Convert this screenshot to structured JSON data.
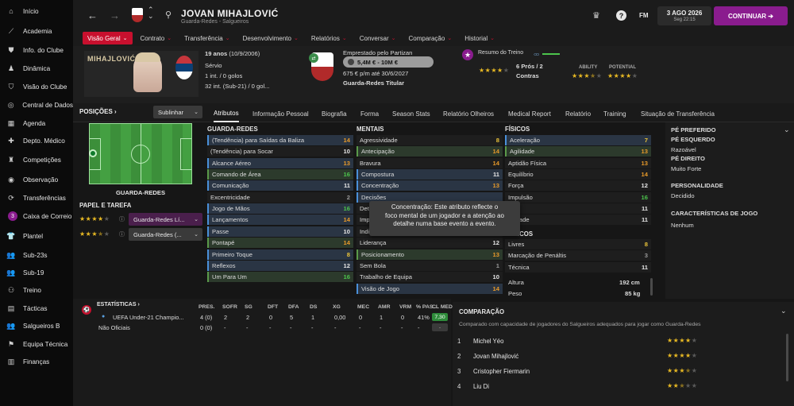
{
  "sidebar": {
    "items": [
      {
        "label": "Início",
        "icon": "home-icon"
      },
      {
        "label": "Academia",
        "icon": "academy-icon"
      },
      {
        "label": "Info. do Clube",
        "icon": "club-info-icon"
      },
      {
        "label": "Dinâmica",
        "icon": "dynamics-icon"
      },
      {
        "label": "Visão do Clube",
        "icon": "club-vision-icon"
      },
      {
        "label": "Central de Dados",
        "icon": "data-hub-icon"
      },
      {
        "label": "Agenda",
        "icon": "calendar-icon"
      },
      {
        "label": "Depto. Médico",
        "icon": "medical-icon"
      },
      {
        "label": "Competições",
        "icon": "trophy-icon"
      },
      {
        "label": "Observação",
        "icon": "scouting-icon"
      },
      {
        "label": "Transferências",
        "icon": "transfers-icon"
      },
      {
        "label": "Caixa de Correio",
        "icon": "inbox-icon",
        "badge": "3"
      },
      {
        "label": "Plantel",
        "icon": "squad-icon"
      },
      {
        "label": "Sub-23s",
        "icon": "u23-icon"
      },
      {
        "label": "Sub-19",
        "icon": "u19-icon"
      },
      {
        "label": "Treino",
        "icon": "training-icon"
      },
      {
        "label": "Tácticas",
        "icon": "tactics-icon"
      },
      {
        "label": "Salgueiros B",
        "icon": "reserve-team-icon"
      },
      {
        "label": "Equipa Técnica",
        "icon": "staff-icon"
      },
      {
        "label": "Finanças",
        "icon": "finances-icon"
      }
    ]
  },
  "header": {
    "player_name": "JOVAN MIHAJLOVIĆ",
    "player_subtitle": "Guarda-Redes - Salgueiros",
    "date": "3 AGO 2026",
    "time": "Seg 22:15",
    "fm_label": "FM",
    "continue_label": "CONTINUAR"
  },
  "nav_tabs": [
    "Visão Geral",
    "Contrato",
    "Transferência",
    "Desenvolvimento",
    "Relatórios",
    "Conversar",
    "Comparação",
    "Historial"
  ],
  "profile": {
    "photo_name": "MIHAJLOVIĆ",
    "age_line": "19 anos",
    "dob": "(10/9/2006)",
    "nationality": "Sérvio",
    "caps1": "1 int. / 0 golos",
    "caps2": "32 int. (Sub-21) / 0 gol...",
    "loan_text": "Emprestado pelo Partizan",
    "value": "5,4M € - 10M €",
    "wage": "675 € p/m até 30/6/2027",
    "role": "Guarda-Redes Titular",
    "scout_title": "Resumo do Treino",
    "pros_cons_1": "6 Prós / 2",
    "pros_cons_2": "Contras",
    "ability_label": "ABILITY",
    "potential_label": "POTENTIAL",
    "training_stars": 4,
    "ability_stars": 3.5,
    "potential_stars": 4
  },
  "positions": {
    "title": "POSIÇÕES",
    "dropdown": "Sublinhar",
    "position_label": "GUARDA-REDES",
    "role_title": "PAPEL E TAREFA",
    "roles": [
      {
        "stars": 4,
        "label": "Guarda-Redes Lí..."
      },
      {
        "stars": 3.5,
        "label": "Guarda-Redes (..."
      }
    ]
  },
  "sub_tabs": [
    "Atributos",
    "Informação Pessoal",
    "Biografia",
    "Forma",
    "Season Stats",
    "Relatório Olheiros",
    "Medical Report",
    "Relatório",
    "Training",
    "Situação de Transferência"
  ],
  "attributes": {
    "gk_title": "GUARDA-REDES",
    "gk": [
      {
        "name": "(Tendência) para Saídas da Baliza",
        "value": "14"
      },
      {
        "name": "(Tendência) para Socar",
        "value": "10"
      },
      {
        "name": "Alcance Aéreo",
        "value": "13"
      },
      {
        "name": "Comando de Área",
        "value": "16"
      },
      {
        "name": "Comunicação",
        "value": "11"
      },
      {
        "name": "Excentricidade",
        "value": "2"
      },
      {
        "name": "Jogo de Mãos",
        "value": "16"
      },
      {
        "name": "Lançamentos",
        "value": "14"
      },
      {
        "name": "Passe",
        "value": "10"
      },
      {
        "name": "Pontapé",
        "value": "14"
      },
      {
        "name": "Primeiro Toque",
        "value": "8"
      },
      {
        "name": "Reflexos",
        "value": "12"
      },
      {
        "name": "Um Para Um",
        "value": "16"
      }
    ],
    "mental_title": "MENTAIS",
    "mental": [
      {
        "name": "Agressividade",
        "value": "8"
      },
      {
        "name": "Antecipação",
        "value": "14"
      },
      {
        "name": "Bravura",
        "value": "14"
      },
      {
        "name": "Compostura",
        "value": "11"
      },
      {
        "name": "Concentração",
        "value": "13"
      },
      {
        "name": "Decisões",
        "value": ""
      },
      {
        "name": "Dete",
        "value": ""
      },
      {
        "name": "Impr",
        "value": ""
      },
      {
        "name": "Indic",
        "value": ""
      },
      {
        "name": "Liderança",
        "value": "12"
      },
      {
        "name": "Posicionamento",
        "value": "13"
      },
      {
        "name": "Sem Bola",
        "value": "1"
      },
      {
        "name": "Trabalho de Equipa",
        "value": "10"
      },
      {
        "name": "Visão de Jogo",
        "value": "14"
      }
    ],
    "physical_title": "FÍSICOS",
    "physical": [
      {
        "name": "Aceleração",
        "value": "7"
      },
      {
        "name": "Agilidade",
        "value": "13"
      },
      {
        "name": "Aptidão Física",
        "value": "13"
      },
      {
        "name": "Equilíbrio",
        "value": "14"
      },
      {
        "name": "Força",
        "value": "12"
      },
      {
        "name": "Impulsão",
        "value": "16"
      },
      {
        "name": "",
        "value": "11"
      },
      {
        "name": "ocidade",
        "value": "11"
      }
    ],
    "tech_title": "ICOS",
    "tech": [
      {
        "name": "Livres",
        "value": "8"
      },
      {
        "name": "Marcação de Penáltis",
        "value": "3"
      },
      {
        "name": "Técnica",
        "value": "11"
      }
    ],
    "height_label": "Altura",
    "height": "192 cm",
    "weight_label": "Peso",
    "weight": "85 kg"
  },
  "tooltip": {
    "line1": "Concentração: Este atributo reflecte o",
    "line2": "foco mental de um jogador e a atenção ao",
    "line3": "detalhe numa base evento a evento."
  },
  "right_panel": {
    "foot_title": "PÉ PREFERIDO",
    "left_title": "PÉ ESQUERDO",
    "left_value": "Razoável",
    "right_title": "PÉ DIREITO",
    "right_value": "Muito Forte",
    "personality_title": "PERSONALIDADE",
    "personality_value": "Decidido",
    "traits_title": "CARACTERÍSTICAS DE JOGO",
    "traits_value": "Nenhum"
  },
  "stats": {
    "title": "ESTATÍSTICAS",
    "columns": [
      "PRES.",
      "SOFR",
      "SG",
      "DFT",
      "DFA",
      "DS",
      "XG",
      "MEC",
      "AMR",
      "VRM",
      "% PAS...",
      "CL MED"
    ],
    "rows": [
      {
        "competition": "UEFA Under-21 Champio...",
        "values": [
          "4 (0)",
          "2",
          "2",
          "0",
          "5",
          "1",
          "0,00",
          "0",
          "1",
          "0",
          "41%"
        ],
        "rating": "7,30"
      },
      {
        "competition": "Não Oficiais",
        "values": [
          "0 (0)",
          "-",
          "-",
          "-",
          "-",
          "-",
          "-",
          "-",
          "-",
          "-",
          "-"
        ],
        "rating": "-"
      }
    ]
  },
  "comparison": {
    "title": "COMPARAÇÃO",
    "subtitle": "Comparado com capacidade de jogadores do Salgueiros adequados para jogar como Guarda-Redes",
    "rows": [
      {
        "rank": "1",
        "name": "Michel Yéo",
        "stars": 4
      },
      {
        "rank": "2",
        "name": "Jovan Mihajlović",
        "stars": 4
      },
      {
        "rank": "3",
        "name": "Cristopher Fiermarin",
        "stars": 3.5
      },
      {
        "rank": "4",
        "name": "Liu Di",
        "stars": 2.5
      }
    ]
  },
  "colors": {
    "accent": "#c8102e",
    "primary": "#8a1c8e",
    "star": "#e8b923"
  }
}
